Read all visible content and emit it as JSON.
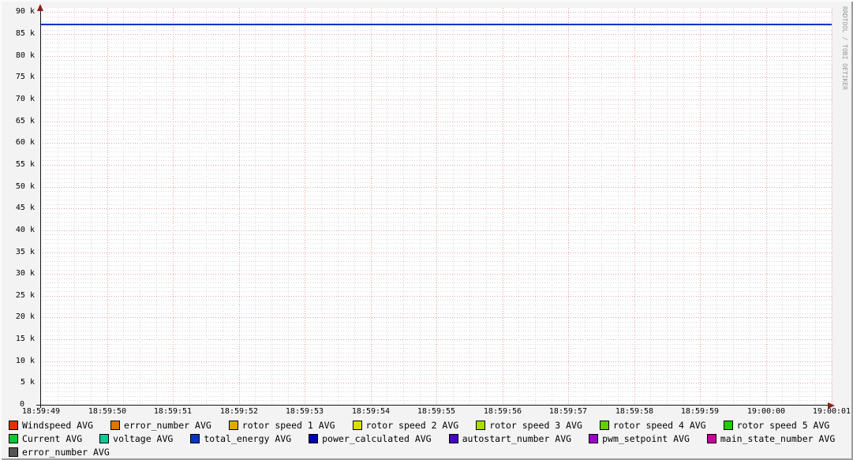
{
  "watermark": "RRDTOOL / TOBI OETIKER",
  "colors": {
    "background": "#F3F3F3",
    "canvas": "#FFFFFF",
    "axis": "#151515",
    "arrow": "#8E1E1E",
    "grid_major": "#E8A2A2",
    "grid_minor": "#D8D8D8",
    "text": "#000000",
    "watermark": "#9A9A9A"
  },
  "chart_data": {
    "type": "line",
    "title": "",
    "grid": {
      "major_color": "#E8A2A2",
      "minor_color": "#D8D8D8",
      "style": "dotted"
    },
    "x_axis": {
      "tick_labels": [
        "18:59:49",
        "18:59:50",
        "18:59:51",
        "18:59:52",
        "18:59:53",
        "18:59:54",
        "18:59:55",
        "18:59:56",
        "18:59:57",
        "18:59:58",
        "18:59:59",
        "19:00:00",
        "19:00:01"
      ],
      "major_step_seconds": 1,
      "minor_divisions_per_major": 4
    },
    "y_axis": {
      "min": 0,
      "max": 90000,
      "major_step": 5000,
      "minor_step": 1000,
      "ticks": [
        {
          "value": 90000,
          "label": "90 k"
        },
        {
          "value": 85000,
          "label": "85 k"
        },
        {
          "value": 80000,
          "label": "80 k"
        },
        {
          "value": 75000,
          "label": "75 k"
        },
        {
          "value": 70000,
          "label": "70 k"
        },
        {
          "value": 65000,
          "label": "65 k"
        },
        {
          "value": 60000,
          "label": "60 k"
        },
        {
          "value": 55000,
          "label": "55 k"
        },
        {
          "value": 50000,
          "label": "50 k"
        },
        {
          "value": 45000,
          "label": "45 k"
        },
        {
          "value": 40000,
          "label": "40 k"
        },
        {
          "value": 35000,
          "label": "35 k"
        },
        {
          "value": 30000,
          "label": "30 k"
        },
        {
          "value": 25000,
          "label": "25 k"
        },
        {
          "value": 20000,
          "label": "20 k"
        },
        {
          "value": 15000,
          "label": "15 k"
        },
        {
          "value": 10000,
          "label": "10 k"
        },
        {
          "value": 5000,
          "label": "5 k"
        },
        {
          "value": 0,
          "label": "0"
        }
      ]
    },
    "series": [
      {
        "name": "total_energy AVG",
        "color": "#0633CC",
        "shape": "constant-horizontal-line",
        "value": 87200,
        "x_span": [
          "18:59:49",
          "19:00:01"
        ]
      }
    ],
    "legend": [
      {
        "label": "Windspeed AVG",
        "color": "#DD3300"
      },
      {
        "label": "error_number AVG",
        "color": "#DD7700"
      },
      {
        "label": "rotor speed 1 AVG",
        "color": "#DDAA00"
      },
      {
        "label": "rotor speed 2 AVG",
        "color": "#DDDD00"
      },
      {
        "label": "rotor speed 3 AVG",
        "color": "#AADD00"
      },
      {
        "label": "rotor speed 4 AVG",
        "color": "#66CC00"
      },
      {
        "label": "rotor speed 5 AVG",
        "color": "#22CC00"
      },
      {
        "label": "Current AVG",
        "color": "#00CC33"
      },
      {
        "label": "voltage AVG",
        "color": "#00CC99"
      },
      {
        "label": "total_energy AVG",
        "color": "#0633CC"
      },
      {
        "label": "power_calculated AVG",
        "color": "#0000AA"
      },
      {
        "label": "autostart_number AVG",
        "color": "#4400CC"
      },
      {
        "label": "pwm_setpoint AVG",
        "color": "#9900CC"
      },
      {
        "label": "main_state_number AVG",
        "color": "#CC0099"
      },
      {
        "label": "error_number AVG",
        "color": "#555555"
      }
    ],
    "legend_rows": [
      7,
      7,
      1
    ],
    "layout": {
      "legend_position": "bottom",
      "grid": true
    }
  }
}
